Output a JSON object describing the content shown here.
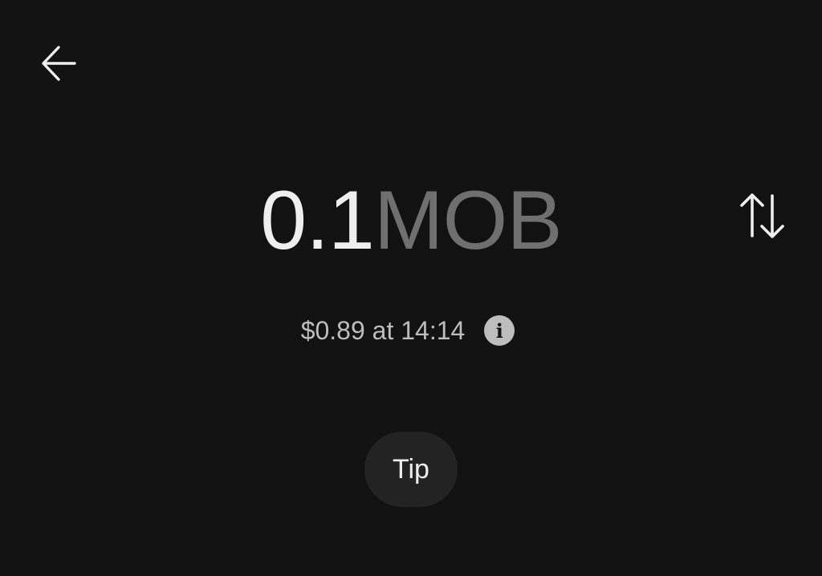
{
  "navigation": {
    "back_icon": "arrow-left-icon"
  },
  "amount": {
    "value": "0.1",
    "currency": "MOB"
  },
  "swap": {
    "icon": "swap-vertical-icon"
  },
  "conversion": {
    "text": "$0.89 at 14:14",
    "info_icon": "info-icon",
    "info_glyph": "i"
  },
  "tip_button": {
    "label": "Tip"
  },
  "colors": {
    "background": "#121212",
    "primary_text": "#eeeeee",
    "muted_text": "#6f6f6f",
    "secondary_text": "#bdbdbd",
    "button_bg": "#232323"
  }
}
